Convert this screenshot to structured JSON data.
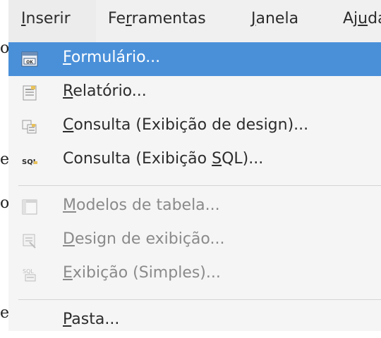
{
  "menubar": {
    "items": [
      {
        "label": "Inserir",
        "mnemonic": "I"
      },
      {
        "label": "Ferramentas",
        "mnemonic": "r"
      },
      {
        "label": "Janela",
        "mnemonic": "J"
      },
      {
        "label": "Ajuda",
        "mnemonic": "u"
      }
    ]
  },
  "dropdown": {
    "items": [
      {
        "label": "Formulário...",
        "icon": "form-icon",
        "enabled": true,
        "highlighted": true
      },
      {
        "label": "Relatório...",
        "icon": "report-icon",
        "enabled": true
      },
      {
        "label": "Consulta (Exibição de design)...",
        "icon": "query-design-icon",
        "enabled": true
      },
      {
        "label": "Consulta (Exibição SQL)...",
        "icon": "sql-icon",
        "enabled": true
      },
      {
        "label": "Modelos de tabela...",
        "icon": "table-model-icon",
        "enabled": false
      },
      {
        "label": "Design de exibição...",
        "icon": "view-design-icon",
        "enabled": false
      },
      {
        "label": "Exibição (Simples)...",
        "icon": "view-simple-icon",
        "enabled": false
      },
      {
        "label": "Pasta...",
        "icon": "",
        "enabled": true
      }
    ]
  },
  "background_fragments": [
    "o",
    "e",
    "o",
    "e"
  ],
  "colors": {
    "highlight": "#4a90d9",
    "menu_bg": "#f5f5f5",
    "disabled_text": "#8a8a8a"
  }
}
